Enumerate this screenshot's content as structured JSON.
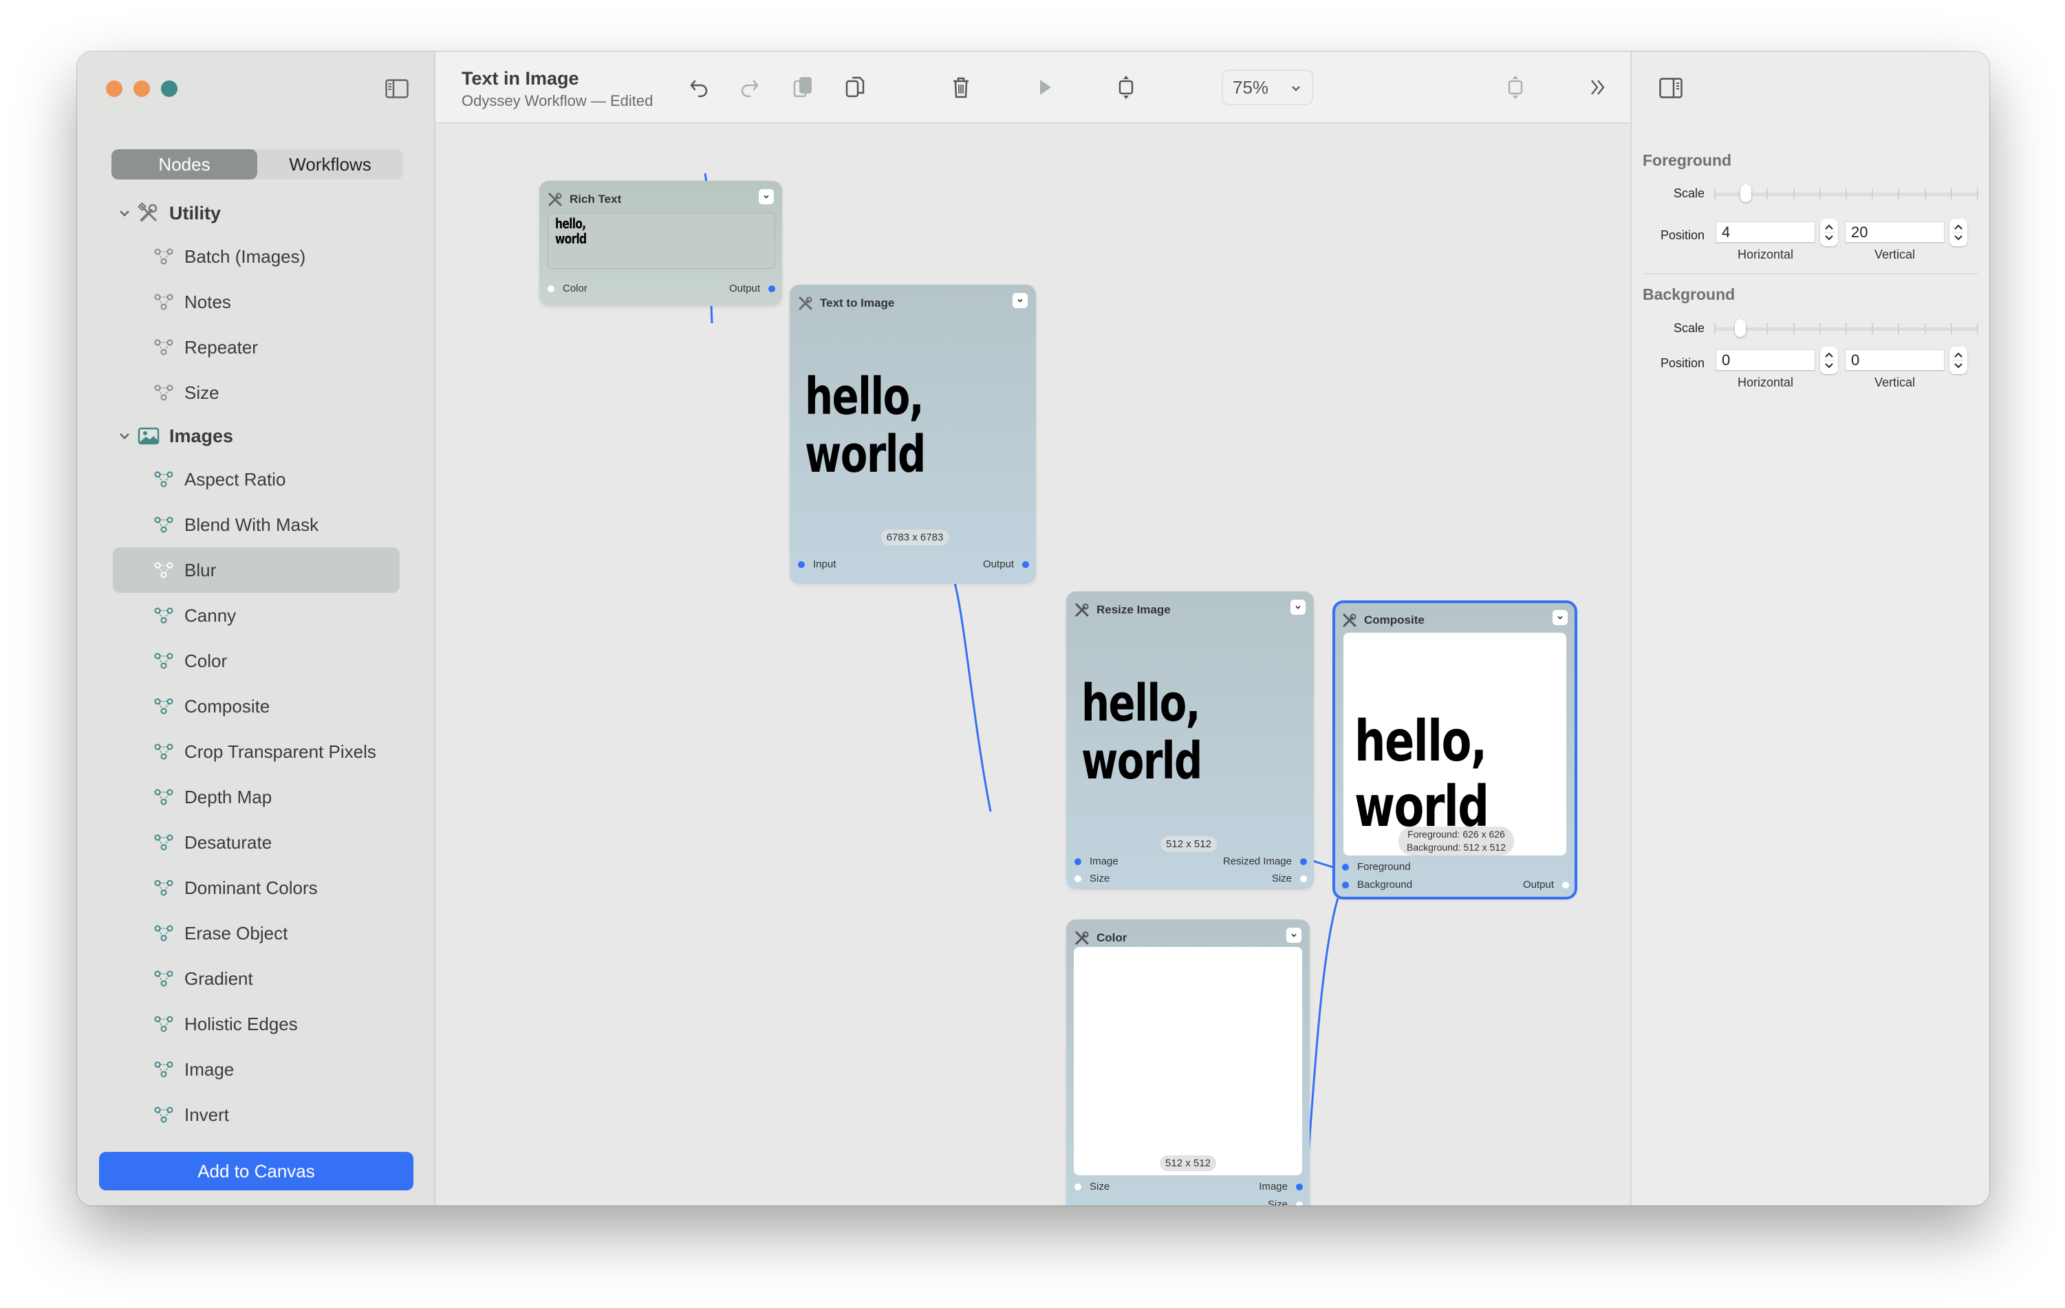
{
  "window": {
    "traffic_lights": {
      "close_color": "#ef9555",
      "minimize_color": "#ef9555",
      "zoom_color": "#3f8a88"
    }
  },
  "sidebar": {
    "tabs": [
      {
        "label": "Nodes",
        "active": true
      },
      {
        "label": "Workflows",
        "active": false
      }
    ],
    "groups": [
      {
        "label": "Utility",
        "icon": "tools-icon",
        "expanded": true,
        "items": [
          {
            "label": "Batch (Images)"
          },
          {
            "label": "Notes"
          },
          {
            "label": "Repeater"
          },
          {
            "label": "Size"
          }
        ]
      },
      {
        "label": "Images",
        "icon": "photo-icon",
        "expanded": true,
        "items": [
          {
            "label": "Aspect Ratio"
          },
          {
            "label": "Blend With Mask"
          },
          {
            "label": "Blur",
            "selected": true
          },
          {
            "label": "Canny"
          },
          {
            "label": "Color"
          },
          {
            "label": "Composite"
          },
          {
            "label": "Crop Transparent Pixels"
          },
          {
            "label": "Depth Map"
          },
          {
            "label": "Desaturate"
          },
          {
            "label": "Dominant Colors"
          },
          {
            "label": "Erase Object"
          },
          {
            "label": "Gradient"
          },
          {
            "label": "Holistic Edges"
          },
          {
            "label": "Image"
          },
          {
            "label": "Invert"
          }
        ]
      }
    ],
    "add_button_label": "Add to Canvas"
  },
  "toolbar": {
    "title": "Text in Image",
    "subtitle": "Odyssey Workflow — Edited",
    "zoom_level": "75%",
    "buttons": [
      "undo-icon",
      "redo-icon",
      "copy-icon",
      "paste-icon",
      "trash-icon",
      "play-icon",
      "fit-vertical-icon",
      "fit-center-icon",
      "more-chevrons-icon"
    ]
  },
  "canvas": {
    "nodes": {
      "rich_text": {
        "title": "Rich Text",
        "content_line1": "hello,",
        "content_line2": "world",
        "inputs": [
          "Color"
        ],
        "outputs": [
          "Output"
        ]
      },
      "text_to_image": {
        "title": "Text to Image",
        "preview_line1": "hello,",
        "preview_line2": "world",
        "dimensions": "6783 x 6783",
        "inputs": [
          "Input"
        ],
        "outputs": [
          "Output"
        ]
      },
      "resize_image": {
        "title": "Resize Image",
        "preview_line1": "hello,",
        "preview_line2": "world",
        "dimensions": "512 x 512",
        "inputs": [
          "Image",
          "Size"
        ],
        "outputs": [
          "Resized Image",
          "Size"
        ]
      },
      "composite": {
        "title": "Composite",
        "selected": true,
        "preview_line1": "hello,",
        "preview_line2": "world",
        "info_line1": "Foreground: 626 x 626",
        "info_line2": "Background: 512 x 512",
        "inputs": [
          "Foreground",
          "Background"
        ],
        "outputs": [
          "Output"
        ]
      },
      "color": {
        "title": "Color",
        "dimensions": "512 x 512",
        "inputs": [
          "Size"
        ],
        "outputs": [
          "Image",
          "Size"
        ]
      }
    },
    "connections": [
      {
        "from": "Rich Text.Output",
        "to": "Text to Image.Input"
      },
      {
        "from": "Text to Image.Output",
        "to": "Resize Image.Image"
      },
      {
        "from": "Resize Image.Resized Image",
        "to": "Composite.Foreground"
      },
      {
        "from": "Color.Image",
        "to": "Composite.Background"
      }
    ],
    "wire_color": "#3571f4"
  },
  "inspector": {
    "foreground": {
      "title": "Foreground",
      "scale_label": "Scale",
      "scale_value_fraction": 0.12,
      "position_label": "Position",
      "horizontal": "4",
      "vertical": "20",
      "horizontal_caption": "Horizontal",
      "vertical_caption": "Vertical"
    },
    "background": {
      "title": "Background",
      "scale_label": "Scale",
      "scale_value_fraction": 0.1,
      "position_label": "Position",
      "horizontal": "0",
      "vertical": "0",
      "horizontal_caption": "Horizontal",
      "vertical_caption": "Vertical"
    }
  },
  "colors": {
    "accent": "#3571f4",
    "teal_icon": "#3f8a88",
    "sidebar_selected": "#c8cdc9"
  }
}
